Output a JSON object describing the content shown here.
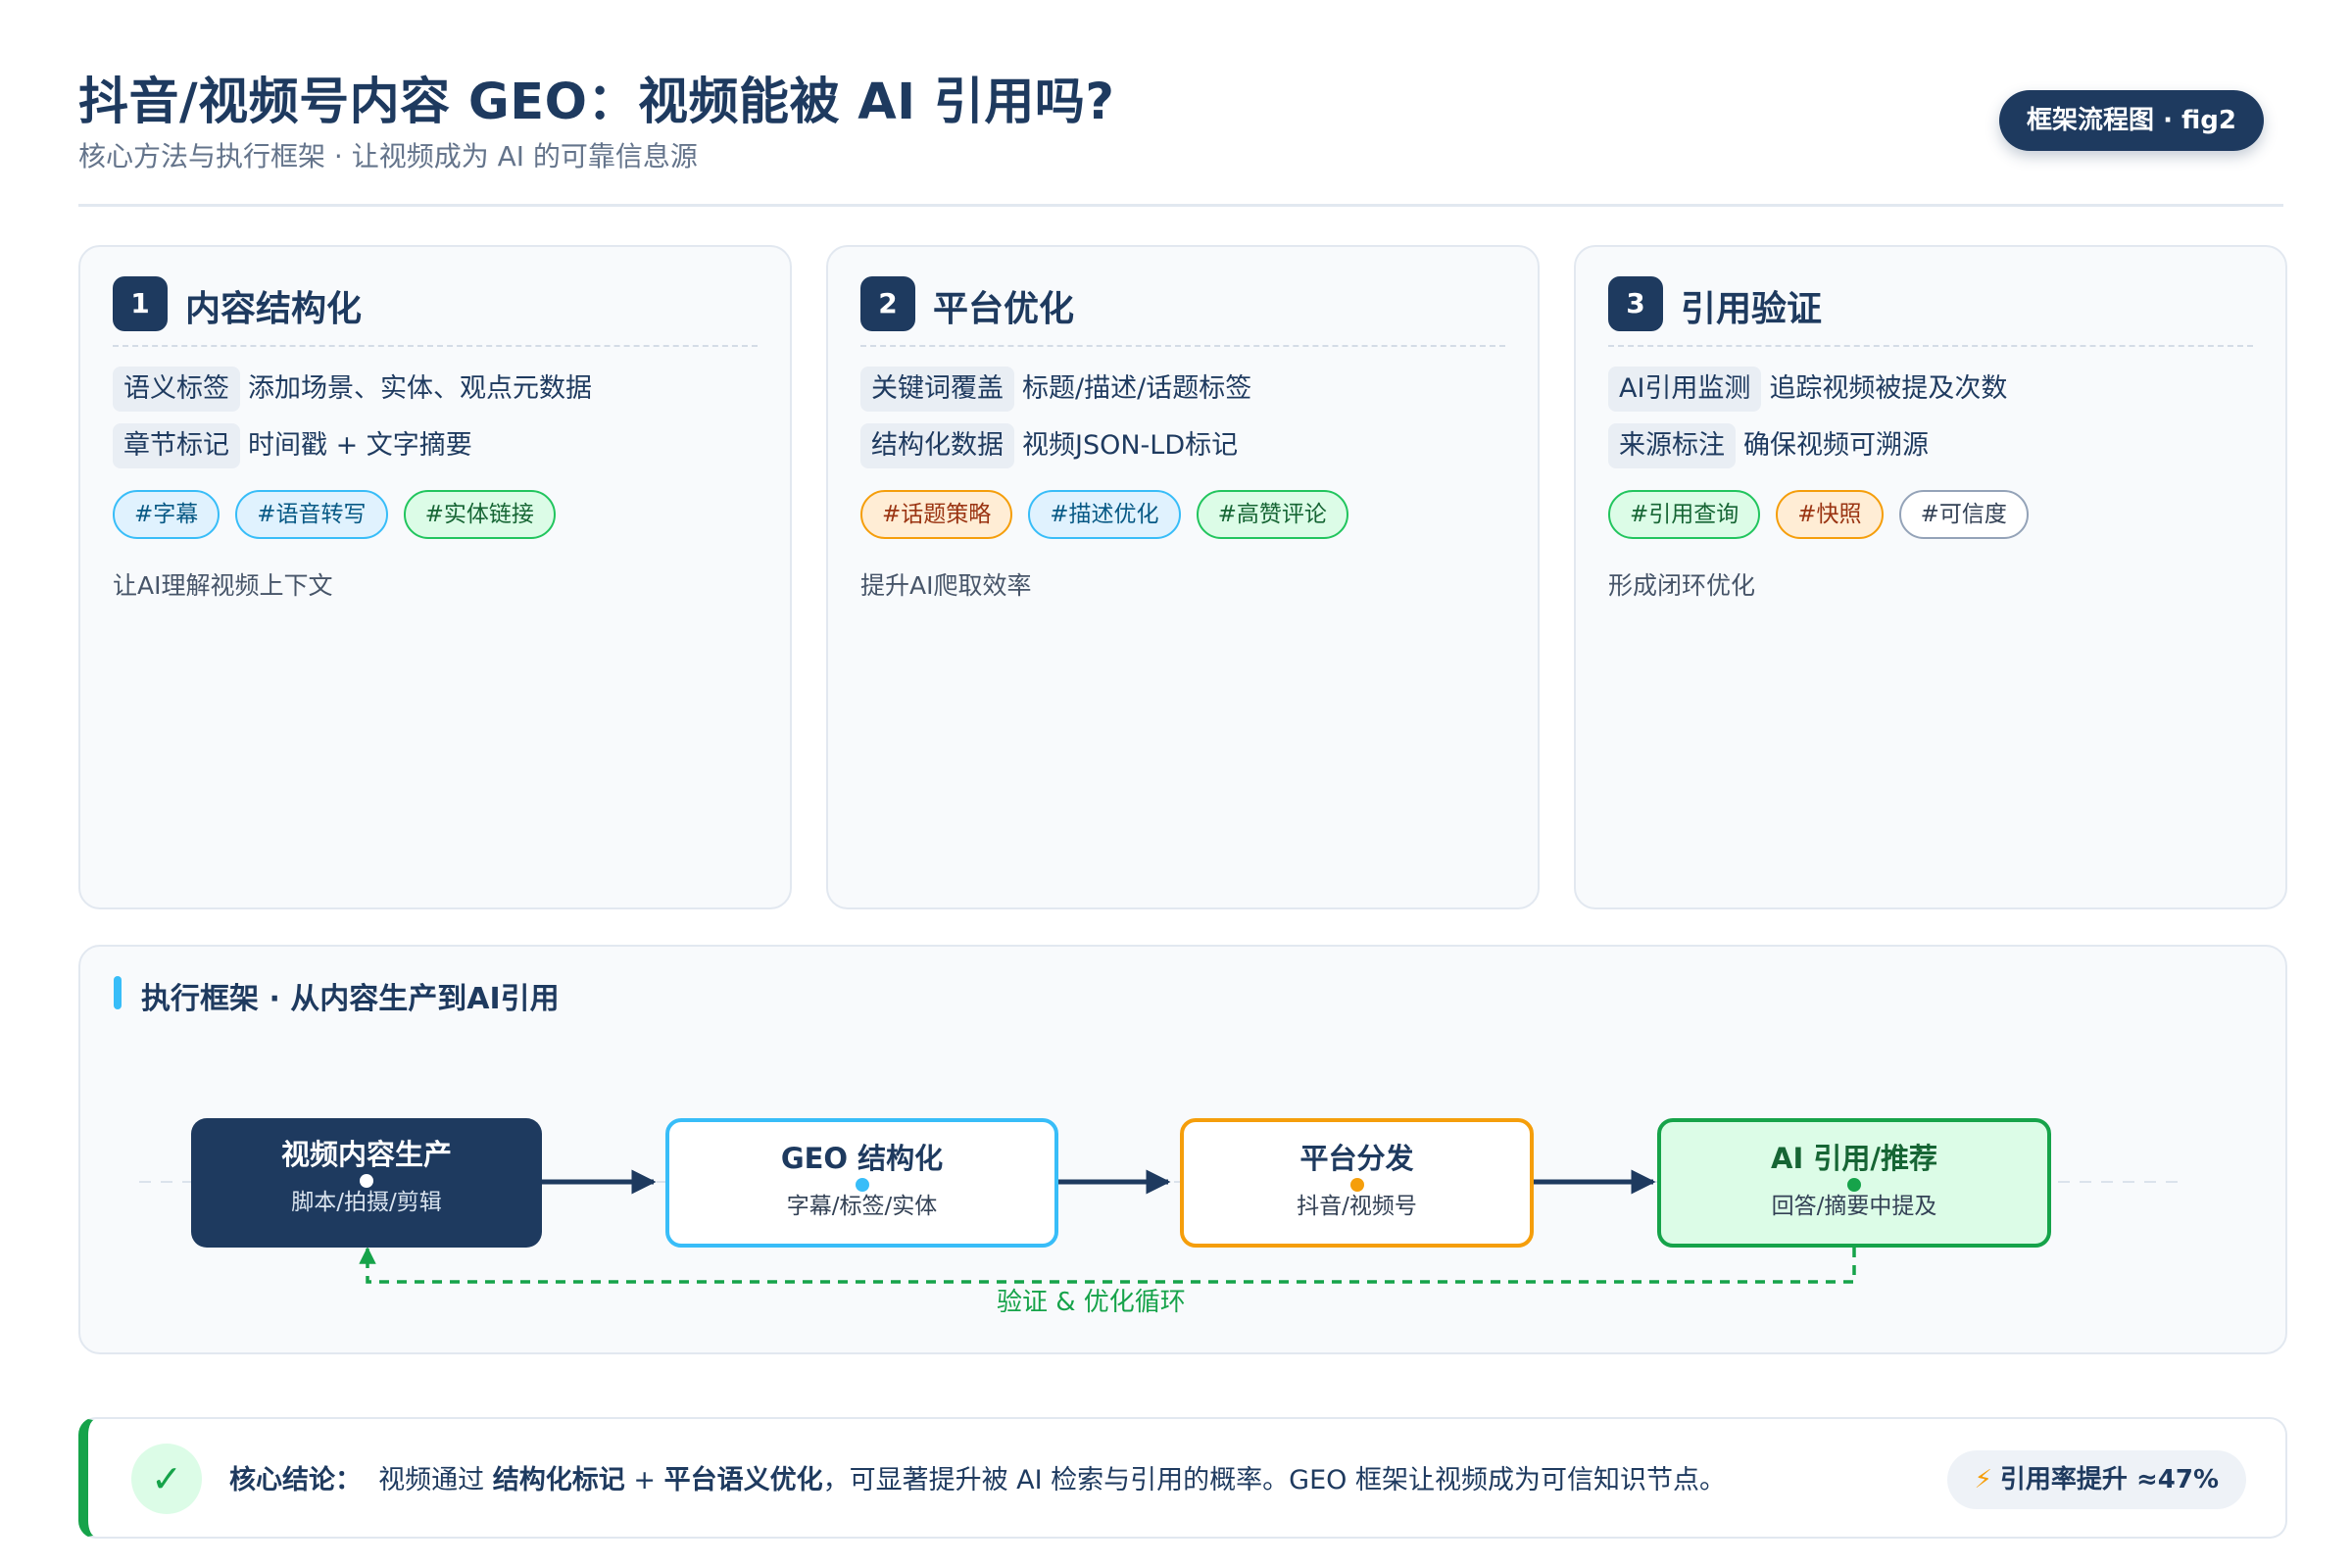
{
  "header": {
    "title": "抖音/视频号内容 GEO：视频能被 AI 引用吗?",
    "subtitle": "核心方法与执行框架 · 让视频成为 AI 的可靠信息源",
    "badge": "框架流程图 · fig2"
  },
  "cards": [
    {
      "num": "1",
      "title": "内容结构化",
      "rows": [
        {
          "tag": "语义标签",
          "text": "添加场景、实体、观点元数据"
        },
        {
          "tag": "章节标记",
          "text": "时间戳 + 文字摘要"
        }
      ],
      "chips": [
        "#字幕",
        "#语音转写",
        "#实体链接"
      ],
      "note": "让AI理解视频上下文"
    },
    {
      "num": "2",
      "title": "平台优化",
      "rows": [
        {
          "tag": "关键词覆盖",
          "text": "标题/描述/话题标签"
        },
        {
          "tag": "结构化数据",
          "text": "视频JSON-LD标记"
        }
      ],
      "chips": [
        "#话题策略",
        "#描述优化",
        "#高赞评论"
      ],
      "note": "提升AI爬取效率"
    },
    {
      "num": "3",
      "title": "引用验证",
      "rows": [
        {
          "tag": "AI引用监测",
          "text": "追踪视频被提及次数"
        },
        {
          "tag": "来源标注",
          "text": "确保视频可溯源"
        }
      ],
      "chips": [
        "#引用查询",
        "#快照",
        "#可信度"
      ],
      "note": "形成闭环优化"
    }
  ],
  "flow": {
    "title": "执行框架 · 从内容生产到AI引用",
    "nodes": [
      {
        "title": "视频内容生产",
        "sub": "脚本/拍摄/剪辑"
      },
      {
        "title": "GEO 结构化",
        "sub": "字幕/标签/实体"
      },
      {
        "title": "平台分发",
        "sub": "抖音/视频号"
      },
      {
        "title": "AI 引用/推荐",
        "sub": "回答/摘要中提及"
      }
    ],
    "loop_label": "验证 & 优化循环"
  },
  "conclusion": {
    "check_icon": "✓",
    "label": "核心结论：",
    "text_1": "视频通过",
    "bold_1": "结构化标记",
    "plus": "+",
    "bold_2": "平台语义优化",
    "text_2": "，可显著提升被 AI 检索与引用的概率。GEO 框架让视频成为可信知识节点。",
    "metric_icon": "⚡",
    "metric": "引用率提升 ≈47%"
  },
  "colors": {
    "navy": "#1e3a5f",
    "blue": "#38bdf8",
    "orange": "#f59e0b",
    "green": "#16a34a"
  }
}
